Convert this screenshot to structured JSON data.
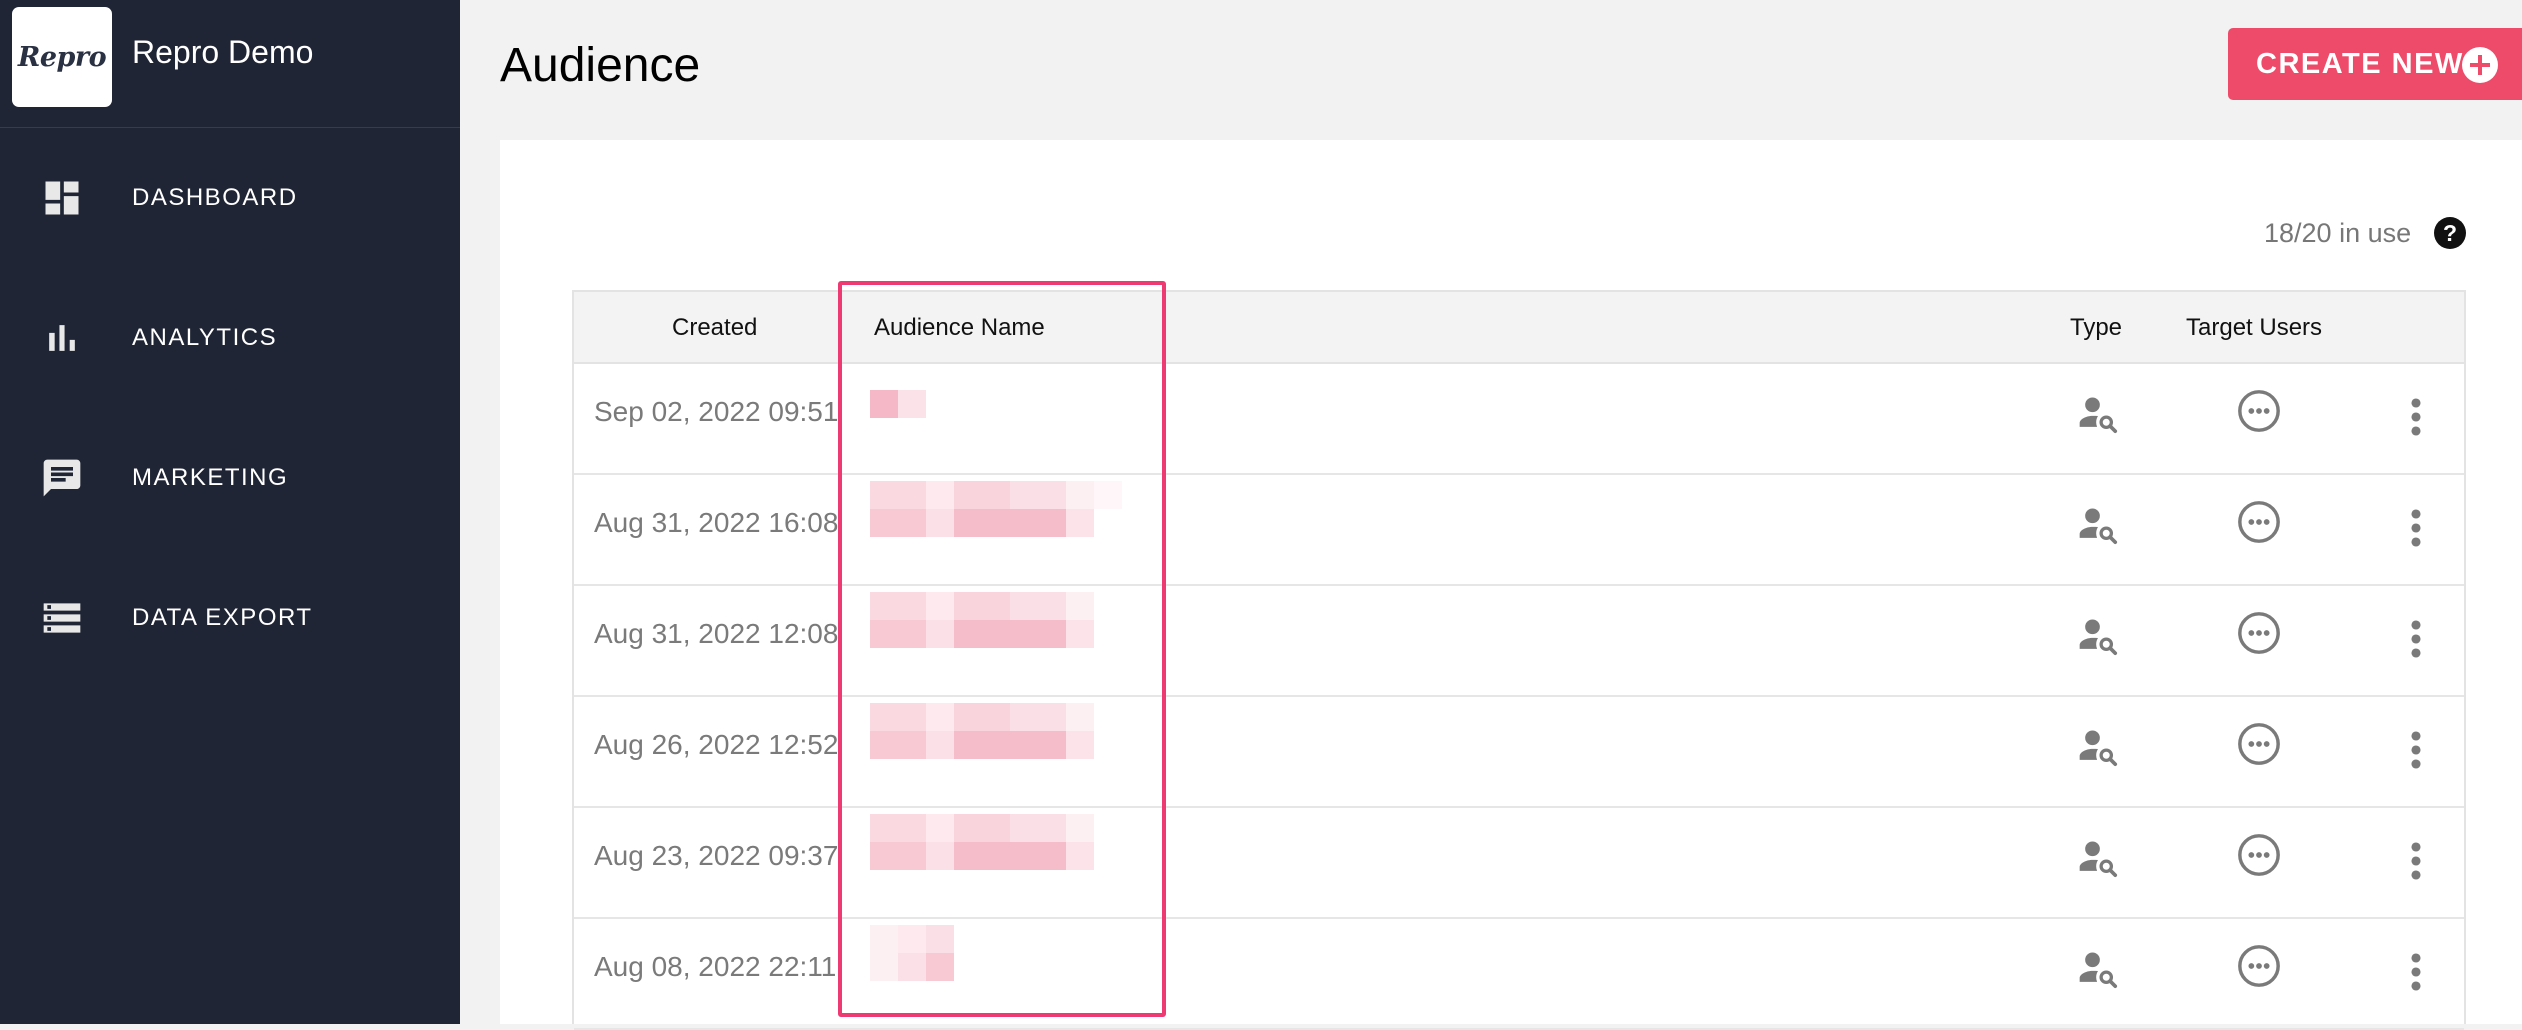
{
  "app": {
    "logo_text": "Repro",
    "name": "Repro Demo"
  },
  "sidebar": {
    "items": [
      {
        "label": "DASHBOARD",
        "icon": "dashboard-icon"
      },
      {
        "label": "ANALYTICS",
        "icon": "bar-chart-icon"
      },
      {
        "label": "MARKETING",
        "icon": "chat-icon"
      },
      {
        "label": "DATA EXPORT",
        "icon": "list-icon"
      }
    ]
  },
  "header": {
    "title": "Audience",
    "create_label": "CREATE NEW"
  },
  "usage": {
    "text": "18/20 in use",
    "help": "?"
  },
  "table": {
    "columns": [
      "Created",
      "Audience Name",
      "Type",
      "Target Users"
    ],
    "rows": [
      {
        "created": "Sep 02, 2022 09:51",
        "name": "",
        "type_icon": "user-search-icon",
        "target_icon": "more-circle-icon"
      },
      {
        "created": "Aug 31, 2022 16:08",
        "name": "",
        "type_icon": "user-search-icon",
        "target_icon": "more-circle-icon"
      },
      {
        "created": "Aug 31, 2022 12:08",
        "name": "",
        "type_icon": "user-search-icon",
        "target_icon": "more-circle-icon"
      },
      {
        "created": "Aug 26, 2022 12:52",
        "name": "",
        "type_icon": "user-search-icon",
        "target_icon": "more-circle-icon"
      },
      {
        "created": "Aug 23, 2022 09:37",
        "name": "",
        "type_icon": "user-search-icon",
        "target_icon": "more-circle-icon"
      },
      {
        "created": "Aug 08, 2022 22:11",
        "name": "",
        "type_icon": "user-search-icon",
        "target_icon": "more-circle-icon"
      }
    ]
  },
  "colors": {
    "sidebar_bg": "#1f2535",
    "accent": "#ee4b6a",
    "highlight": "#ee3a72"
  }
}
